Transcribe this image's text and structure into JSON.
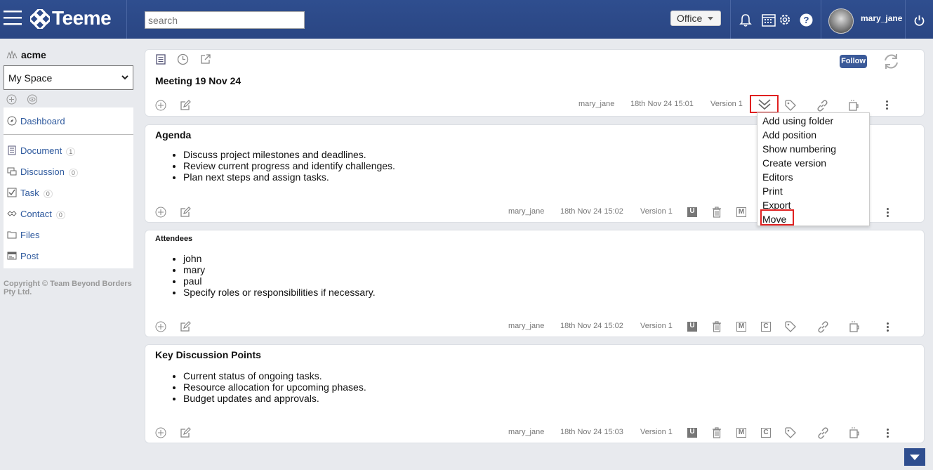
{
  "app": {
    "brand": "Teeme",
    "search_placeholder": "search",
    "office_label": "Office",
    "username": "mary_jane"
  },
  "sidebar": {
    "org": "acme",
    "space_select": "My Space",
    "dashboard": "Dashboard",
    "items": [
      {
        "label": "Document",
        "count": "1",
        "icon": "document-icon"
      },
      {
        "label": "Discussion",
        "count": "0",
        "icon": "discussion-icon"
      },
      {
        "label": "Task",
        "count": "0",
        "icon": "task-icon"
      },
      {
        "label": "Contact",
        "count": "0",
        "icon": "contact-icon"
      },
      {
        "label": "Files",
        "count": "",
        "icon": "folder-icon"
      },
      {
        "label": "Post",
        "count": "",
        "icon": "post-icon"
      }
    ],
    "copyright": "Copyright © Team Beyond Borders Pty Ltd."
  },
  "doc": {
    "title": "Meeting 19 Nov 24",
    "follow": "Follow",
    "author": "mary_jane",
    "time": "18th Nov 24 15:01",
    "version": "Version 1"
  },
  "sections": [
    {
      "title": "Agenda",
      "items": [
        "Discuss project milestones and deadlines.",
        "Review current progress and identify challenges.",
        "Plan next steps and assign tasks."
      ],
      "author": "mary_jane",
      "time": "18th Nov 24 15:02",
      "version": "Version 1"
    },
    {
      "title": "Attendees",
      "items": [
        "john",
        "mary",
        "paul",
        "Specify roles or responsibilities if necessary."
      ],
      "author": "mary_jane",
      "time": "18th Nov 24 15:02",
      "version": "Version 1"
    },
    {
      "title": "Key Discussion Points",
      "items": [
        "Current status of ongoing tasks.",
        "Resource allocation for upcoming phases.",
        "Budget updates and approvals."
      ],
      "author": "mary_jane",
      "time": "18th Nov 24 15:03",
      "version": "Version 1"
    }
  ],
  "badges": {
    "u": "U",
    "m": "M",
    "c": "C"
  },
  "menu": [
    "Add using folder",
    "Add position",
    "Show numbering",
    "Create version",
    "Editors",
    "Print",
    "Export",
    "Move"
  ]
}
